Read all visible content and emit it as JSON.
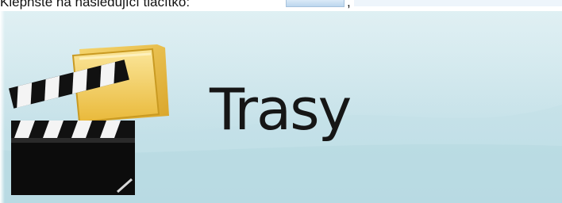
{
  "instruction": {
    "text": "Klepnšte na následující tlačítko:",
    "separator": ","
  },
  "menu_item": {
    "title": "Trasy",
    "icon": "folder-clapperboard-icon"
  },
  "colors": {
    "background_top": "#d2e9ee",
    "background_bottom": "#bcdde5",
    "folder": "#f2c94c",
    "clapper": "#111111"
  }
}
